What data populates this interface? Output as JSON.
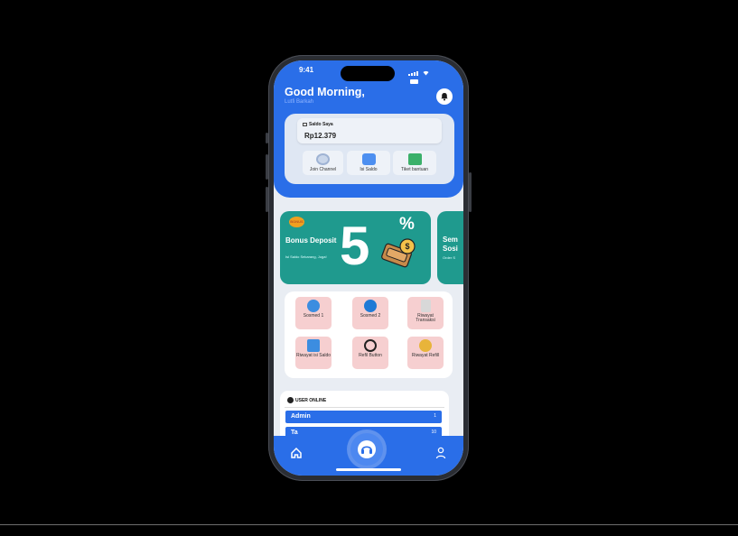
{
  "status_bar": {
    "time": "9:41"
  },
  "header": {
    "greeting": "Good Morning,",
    "sub": "Lutfi Barkah"
  },
  "wallet": {
    "title": "Saldo Saya",
    "balance": "Rp12.379",
    "actions": [
      {
        "label": "Join Channel",
        "icon": "channel-icon"
      },
      {
        "label": "Isi Saldo",
        "icon": "wallet-icon"
      },
      {
        "label": "Tiket bantuan",
        "icon": "ticket-icon"
      }
    ]
  },
  "banners": [
    {
      "badge": "BONUS",
      "title": "Bonus Deposit",
      "sub": "Isi Saldo Sekarang, Juga!",
      "big": "5",
      "pct": "%"
    },
    {
      "title": "Sem Sosi",
      "sub": "Order S"
    }
  ],
  "menu": [
    {
      "label": "Sosmed 1",
      "icon": "cart-icon"
    },
    {
      "label": "Sosmed 2",
      "icon": "cart-icon"
    },
    {
      "label": "Riwayat Transaksi",
      "icon": "receipt-icon"
    },
    {
      "label": "Riwayat isi Saldo",
      "icon": "wallet-history-icon"
    },
    {
      "label": "Refil Button",
      "icon": "refresh-icon"
    },
    {
      "label": "Riwayat Refill",
      "icon": "refill-history-icon"
    }
  ],
  "users_online": {
    "title": "USER ONLINE",
    "rows": [
      {
        "name": "Admin",
        "count": "1"
      },
      {
        "name": "Ta",
        "count": "10"
      }
    ]
  },
  "nav": {
    "items": [
      "home-icon",
      "support-icon",
      "profile-icon"
    ]
  },
  "colors": {
    "primary": "#2a6ee8",
    "banner": "#1f9a8e",
    "menu_tile": "#f6cfd0"
  }
}
